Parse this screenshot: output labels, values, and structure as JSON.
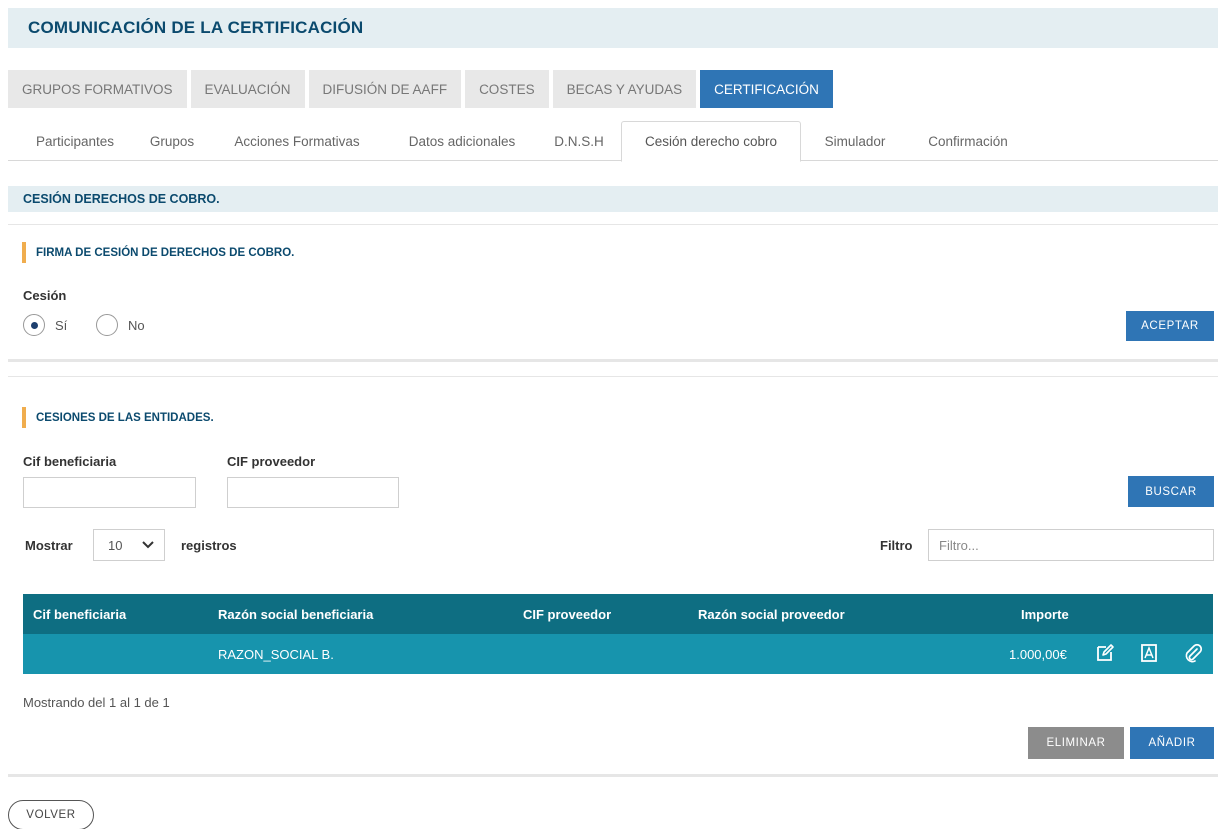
{
  "header": {
    "title": "COMUNICACIÓN DE LA CERTIFICACIÓN"
  },
  "main_tabs": [
    {
      "label": "GRUPOS FORMATIVOS",
      "active": false
    },
    {
      "label": "EVALUACIÓN",
      "active": false
    },
    {
      "label": "DIFUSIÓN DE AAFF",
      "active": false
    },
    {
      "label": "COSTES",
      "active": false
    },
    {
      "label": "BECAS Y AYUDAS",
      "active": false
    },
    {
      "label": "CERTIFICACIÓN",
      "active": true
    }
  ],
  "sub_tabs": [
    {
      "label": "Participantes",
      "active": false
    },
    {
      "label": "Grupos",
      "active": false
    },
    {
      "label": "Acciones Formativas",
      "active": false
    },
    {
      "label": "Datos adicionales",
      "active": false
    },
    {
      "label": "D.N.S.H",
      "active": false
    },
    {
      "label": "Cesión derecho cobro",
      "active": true
    },
    {
      "label": "Simulador",
      "active": false
    },
    {
      "label": "Confirmación",
      "active": false
    }
  ],
  "section": {
    "title": "CESIÓN DERECHOS DE COBRO."
  },
  "firma_panel": {
    "title": "FIRMA DE CESIÓN DE DERECHOS DE COBRO.",
    "cesion_label": "Cesión",
    "options": [
      {
        "label": "Sí",
        "selected": true
      },
      {
        "label": "No",
        "selected": false
      }
    ],
    "accept_button": "ACEPTAR"
  },
  "entidades_panel": {
    "title": "CESIONES DE LAS ENTIDADES.",
    "cif_beneficiaria_label": "Cif beneficiaria",
    "cif_beneficiaria_value": "",
    "cif_proveedor_label": "CIF proveedor",
    "cif_proveedor_value": "",
    "search_button": "BUSCAR",
    "show_label": "Mostrar",
    "page_size": "10",
    "records_label": "registros",
    "filter_label": "Filtro",
    "filter_placeholder": "Filtro...",
    "table": {
      "columns": [
        "Cif beneficiaria",
        "Razón social beneficiaria",
        "CIF proveedor",
        "Razón social proveedor",
        "Importe"
      ],
      "rows": [
        {
          "cif_beneficiaria": "",
          "razon_social_beneficiaria": "RAZON_SOCIAL B.",
          "cif_proveedor": "",
          "razon_social_proveedor": "",
          "importe": "1.000,00€"
        }
      ]
    },
    "pagination_info": "Mostrando del 1 al 1 de 1",
    "delete_button": "ELIMINAR",
    "add_button": "AÑADIR"
  },
  "back_button": "VOLVER",
  "colors": {
    "accent_blue": "#2f75b5",
    "table_header": "#0e6e82",
    "table_row": "#1794ad",
    "panel_marker": "#f0ad4e",
    "title_text": "#0b4a6e"
  }
}
